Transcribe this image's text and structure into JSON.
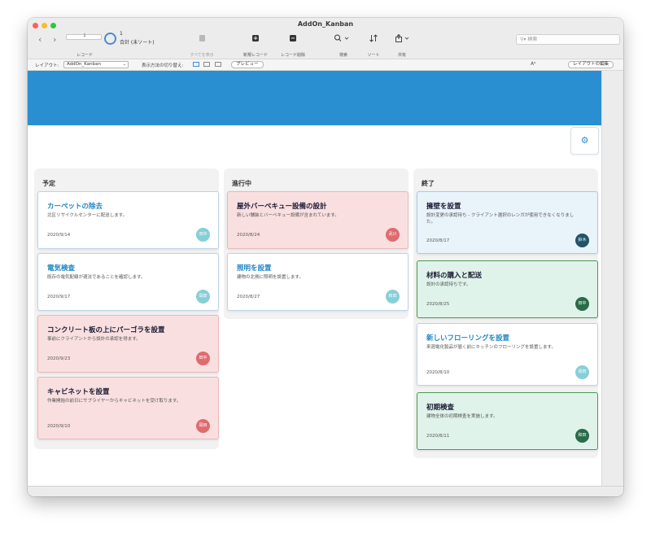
{
  "window": {
    "title": "AddOn_Kanban"
  },
  "toolbar": {
    "record_slider_value": "1",
    "record_count": "1",
    "record_total": "合計 (未ソート)",
    "records_label": "レコード",
    "show_all_label": "すべてを表示",
    "new_record_label": "新規レコード",
    "delete_record_label": "レコード削除",
    "find_label": "検索",
    "sort_label": "ソート",
    "share_label": "共有",
    "search_placeholder": "検索"
  },
  "layoutbar": {
    "layout_label": "レイアウト:",
    "layout_value": "AddOn_Kanban",
    "view_as_label": "表示方法の切り替え:",
    "preview_label": "プレビュー",
    "edit_layout_label": "レイアウトの編集"
  },
  "colors": {
    "banner": "#2a8fd0",
    "accent_blue": "#1f86c7",
    "card_pink": "#f9dfe0",
    "card_green": "#dff3ea",
    "card_lightblue": "#e9f3fa",
    "avatar_teal": "#87cfd8",
    "avatar_red": "#e06b6f",
    "avatar_dark": "#23536a",
    "avatar_green": "#2a6b4a"
  },
  "board": {
    "columns": [
      {
        "title": "予定",
        "cards": [
          {
            "title": "カーペットの除去",
            "desc": "北区リサイクルセンターに配送します。",
            "date": "2020/9/14",
            "assignee": "田中",
            "style": "white",
            "avatar_color": "#87cfd8"
          },
          {
            "title": "電気検査",
            "desc": "既存の電気配線が適法であることを確認します。",
            "date": "2020/9/17",
            "assignee": "岡田",
            "style": "white",
            "avatar_color": "#87cfd8"
          },
          {
            "title": "コンクリート板の上にパーゴラを設置",
            "desc": "事前にクライアントから設計の承認を得ます。",
            "date": "2020/9/23",
            "assignee": "田中",
            "style": "pink",
            "avatar_color": "#e06b6f"
          },
          {
            "title": "キャビネットを設置",
            "desc": "作業開始の前日にサプライヤーからキャビネットを受け取ります。",
            "date": "2020/9/10",
            "assignee": "岡田",
            "style": "pink",
            "avatar_color": "#e06b6f"
          }
        ]
      },
      {
        "title": "進行中",
        "cards": [
          {
            "title": "屋外バーベキュー設備の設計",
            "desc": "新しい舗装とバーベキュー設備が含まれています。",
            "date": "2020/8/24",
            "assignee": "武川",
            "style": "pink",
            "avatar_color": "#e06b6f"
          },
          {
            "title": "照明を設置",
            "desc": "建物の北側に照明を設置します。",
            "date": "2020/8/27",
            "assignee": "和田",
            "style": "white",
            "avatar_color": "#87cfd8"
          }
        ]
      },
      {
        "title": "終了",
        "cards": [
          {
            "title": "擁壁を設置",
            "desc": "設計変更の承認待ち - クライアント選択のレンガが使用できなくなりました。",
            "date": "2020/8/17",
            "assignee": "鈴木",
            "style": "lightblue",
            "avatar_color": "#23536a"
          },
          {
            "title": "材料の購入と配送",
            "desc": "設計の承認待ちです。",
            "date": "2020/8/25",
            "assignee": "田中",
            "style": "green",
            "avatar_color": "#2a6b4a"
          },
          {
            "title": "新しいフローリングを設置",
            "desc": "来週電化製品が届く前にキッチンのフローリングを設置します。",
            "date": "2020/8/10",
            "assignee": "岡田",
            "style": "white",
            "avatar_color": "#87cfd8"
          },
          {
            "title": "初期検査",
            "desc": "建物全体の初期検査を実施します。",
            "date": "2020/8/11",
            "assignee": "和田",
            "style": "green",
            "avatar_color": "#2a6b4a"
          }
        ]
      }
    ]
  }
}
